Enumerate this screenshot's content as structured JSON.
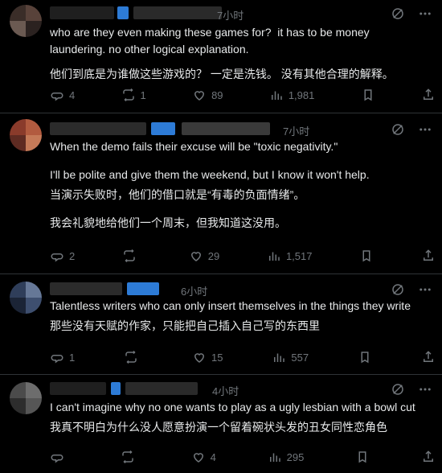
{
  "tweets": [
    {
      "time": "7小时",
      "text_lines": [
        "who are they even making these games for?  it has to be money laundering. no other logical explanation.",
        "他们到底是为谁做这些游戏的？ 一定是洗钱。 没有其他合理的解释。"
      ],
      "metrics": {
        "replies": "4",
        "retweets": "1",
        "likes": "89",
        "views": "1,981"
      }
    },
    {
      "time": "7小时",
      "text_lines": [
        "When the demo fails their excuse will be \"toxic negativity.\"",
        "I'll be polite and give them the weekend, but I know it won't help.",
        "当演示失败时，他们的借口就是“有毒的负面情绪”。",
        "我会礼貌地给他们一个周末，但我知道这没用。"
      ],
      "metrics": {
        "replies": "2",
        "retweets": "",
        "likes": "29",
        "views": "1,517"
      }
    },
    {
      "time": "6小时",
      "text_lines": [
        "Talentless writers who can only insert themselves in the things they write",
        "那些没有天赋的作家，只能把自己插入自己写的东西里"
      ],
      "metrics": {
        "replies": "1",
        "retweets": "",
        "likes": "15",
        "views": "557"
      }
    },
    {
      "time": "4小时",
      "text_lines": [
        "I can't imagine why no one wants to play as a ugly lesbian with a bowl cut",
        "我真不明白为什么没人愿意扮演一个留着碗状头发的丑女同性恋角色"
      ],
      "metrics": {
        "replies": "",
        "retweets": "",
        "likes": "4",
        "views": "295"
      }
    }
  ],
  "colors": {
    "background": "#000000",
    "text": "#e7e9ea",
    "muted": "#71767b",
    "divider": "#2f3336"
  }
}
